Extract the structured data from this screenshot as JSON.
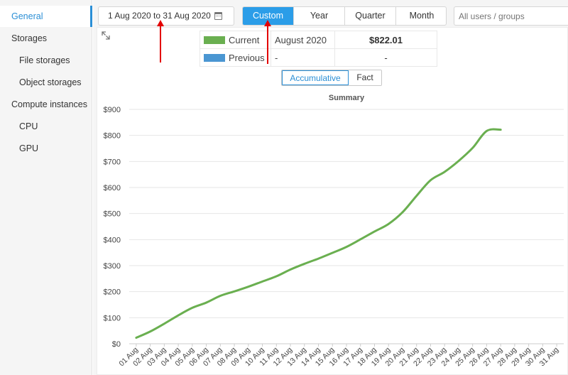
{
  "sidebar": {
    "items": [
      {
        "label": "General",
        "level": 1,
        "active": true
      },
      {
        "label": "Storages",
        "level": 1,
        "active": false
      },
      {
        "label": "File storages",
        "level": 2,
        "active": false
      },
      {
        "label": "Object storages",
        "level": 2,
        "active": false
      },
      {
        "label": "Compute instances",
        "level": 1,
        "active": false
      },
      {
        "label": "CPU",
        "level": 2,
        "active": false
      },
      {
        "label": "GPU",
        "level": 2,
        "active": false
      }
    ]
  },
  "toolbar": {
    "date_range": "1 Aug 2020 to 31 Aug 2020",
    "date_icon": "calendar-icon",
    "periods": [
      "Custom",
      "Year",
      "Quarter",
      "Month"
    ],
    "active_period": "Custom",
    "users_placeholder": "All users / groups"
  },
  "legend": {
    "rows": [
      {
        "name": "Current",
        "color": "#6aaf50",
        "period": "August 2020",
        "value": "$822.01"
      },
      {
        "name": "Previous",
        "color": "#4a96d2",
        "period": "-",
        "value": "-"
      }
    ]
  },
  "mode": {
    "options": [
      "Accumulative",
      "Fact"
    ],
    "active": "Accumulative"
  },
  "chart_data": {
    "type": "line",
    "title": "Summary",
    "xlabel": "",
    "ylabel": "",
    "categories": [
      "01 Aug",
      "02 Aug",
      "03 Aug",
      "04 Aug",
      "05 Aug",
      "06 Aug",
      "07 Aug",
      "08 Aug",
      "09 Aug",
      "10 Aug",
      "11 Aug",
      "12 Aug",
      "13 Aug",
      "14 Aug",
      "15 Aug",
      "16 Aug",
      "17 Aug",
      "18 Aug",
      "19 Aug",
      "20 Aug",
      "21 Aug",
      "22 Aug",
      "23 Aug",
      "24 Aug",
      "25 Aug",
      "26 Aug",
      "27 Aug",
      "28 Aug",
      "29 Aug",
      "30 Aug",
      "31 Aug"
    ],
    "y_ticks": [
      "$0",
      "$100",
      "$200",
      "$300",
      "$400",
      "$500",
      "$600",
      "$700",
      "$800",
      "$900"
    ],
    "ylim": [
      0,
      900
    ],
    "grid": true,
    "series": [
      {
        "name": "Current",
        "color": "#6aaf50",
        "values": [
          23,
          47,
          77,
          109,
          138,
          158,
          184,
          201,
          219,
          239,
          259,
          285,
          307,
          327,
          349,
          372,
          401,
          431,
          460,
          505,
          568,
          628,
          660,
          702,
          752,
          817,
          822
        ]
      }
    ]
  },
  "annotations": {
    "arrow_color": "#e30000"
  }
}
